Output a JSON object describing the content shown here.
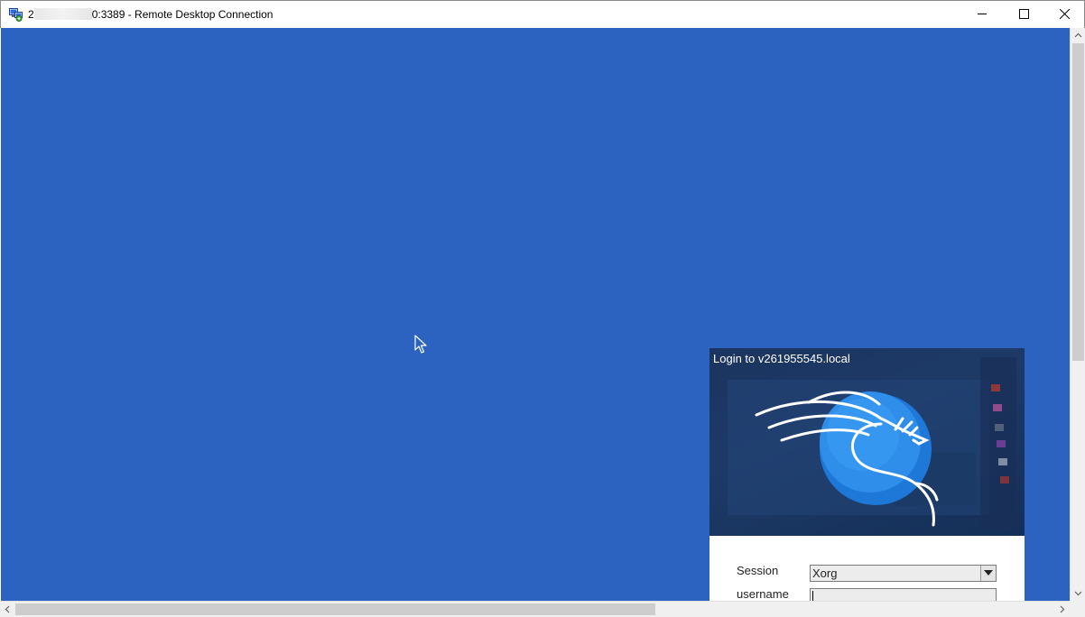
{
  "window": {
    "title_prefix": "2",
    "title_suffix": "0:3389 - Remote Desktop Connection",
    "icons": {
      "app": "remote-desktop-icon",
      "minimize": "minimize-icon",
      "maximize": "maximize-icon",
      "close": "close-icon"
    }
  },
  "desktop": {
    "background_color": "#2c63c0"
  },
  "login_dialog": {
    "title": "Login to v261955545.local",
    "banner_logo": "kali-dragon-icon",
    "session_label": "Session",
    "session_value": "Xorg",
    "username_label": "username",
    "username_value": ""
  },
  "scrollbars": {
    "vertical_icons": [
      "chevron-up-icon",
      "chevron-down-icon"
    ],
    "horizontal_icons": [
      "chevron-left-icon",
      "chevron-right-icon"
    ]
  }
}
